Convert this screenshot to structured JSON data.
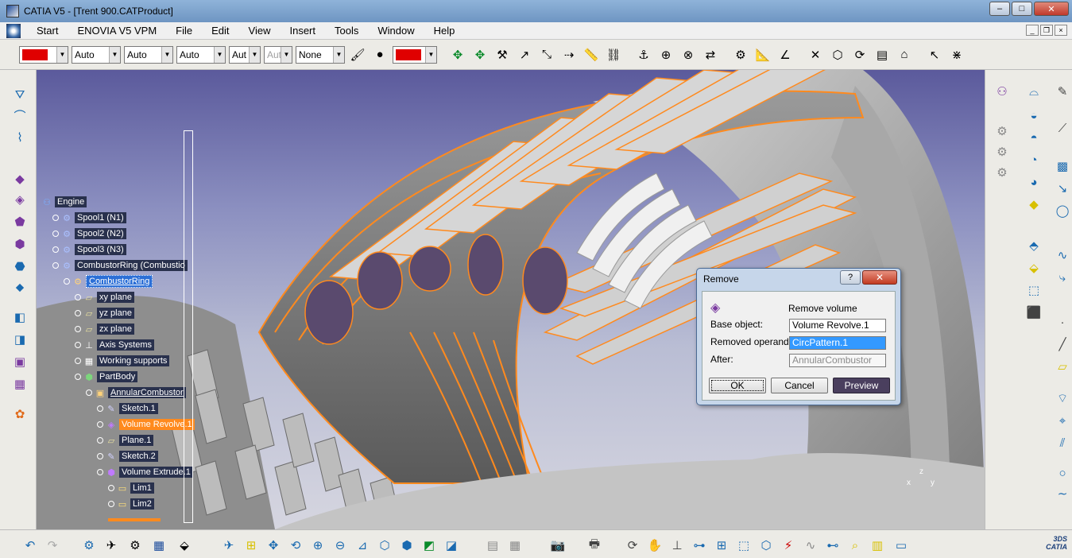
{
  "window": {
    "title": "CATIA V5 - [Trent 900.CATProduct]",
    "min": "–",
    "max": "□",
    "close": "✕"
  },
  "menu": [
    "Start",
    "ENOVIA V5 VPM",
    "File",
    "Edit",
    "View",
    "Insert",
    "Tools",
    "Window",
    "Help"
  ],
  "toolbar": {
    "fill_color": "#e00000",
    "line_color": "#e00000",
    "combos": [
      "Auto",
      "Auto",
      "Auto",
      "Aut",
      "Aut",
      "None"
    ],
    "disabled_combo": "Aut"
  },
  "tree": {
    "items": [
      {
        "label": "Engine",
        "icon": "product-icon",
        "level": 0,
        "style": ""
      },
      {
        "label": "Spool1 (N1)",
        "icon": "component-icon",
        "level": 1,
        "style": ""
      },
      {
        "label": "Spool2 (N2)",
        "icon": "component-icon",
        "level": 1,
        "style": ""
      },
      {
        "label": "Spool3 (N3)",
        "icon": "component-icon",
        "level": 1,
        "style": ""
      },
      {
        "label": "CombustorRing (Combustio",
        "icon": "component-icon",
        "level": 1,
        "style": ""
      },
      {
        "label": "CombustorRing",
        "icon": "part-icon",
        "level": 2,
        "style": "current"
      },
      {
        "label": "xy plane",
        "icon": "plane-icon",
        "level": 3,
        "style": ""
      },
      {
        "label": "yz plane",
        "icon": "plane-icon",
        "level": 3,
        "style": ""
      },
      {
        "label": "zx plane",
        "icon": "plane-icon",
        "level": 3,
        "style": ""
      },
      {
        "label": "Axis Systems",
        "icon": "axis-icon",
        "level": 3,
        "style": ""
      },
      {
        "label": "Working supports",
        "icon": "grid-icon",
        "level": 3,
        "style": ""
      },
      {
        "label": "PartBody",
        "icon": "body-icon",
        "level": 3,
        "style": ""
      },
      {
        "label": "AnnularCombustor",
        "icon": "geoset-icon",
        "level": 4,
        "style": "underline"
      },
      {
        "label": "Sketch.1",
        "icon": "sketch-icon",
        "level": 5,
        "style": ""
      },
      {
        "label": "Volume Revolve.1",
        "icon": "revolve-icon",
        "level": 5,
        "style": "selected"
      },
      {
        "label": "Plane.1",
        "icon": "plane-icon",
        "level": 5,
        "style": ""
      },
      {
        "label": "Sketch.2",
        "icon": "sketch-icon",
        "level": 5,
        "style": ""
      },
      {
        "label": "Volume Extrude.1",
        "icon": "extrude-icon",
        "level": 5,
        "style": ""
      },
      {
        "label": "Lim1",
        "icon": "limit-icon",
        "level": 6,
        "style": ""
      },
      {
        "label": "Lim2",
        "icon": "limit-icon",
        "level": 6,
        "style": ""
      }
    ]
  },
  "dialog": {
    "title": "Remove",
    "help": "?",
    "close": "✕",
    "heading": "Remove volume",
    "base_label": "Base object:",
    "base_value": "Volume Revolve.1",
    "removed_label": "Removed operand",
    "removed_value": "CircPattern.1",
    "after_label": "After:",
    "after_value": "AnnularCombustor",
    "ok": "OK",
    "cancel": "Cancel",
    "preview": "Preview"
  },
  "compass": {
    "z": "z",
    "x": "x",
    "y": "y"
  },
  "logo": {
    "brand": "CATIA",
    "mark": "3DS"
  },
  "colors": {
    "selection": "#ff8a1e",
    "tree_bg": "#29314d",
    "highlight": "#3399ff"
  }
}
